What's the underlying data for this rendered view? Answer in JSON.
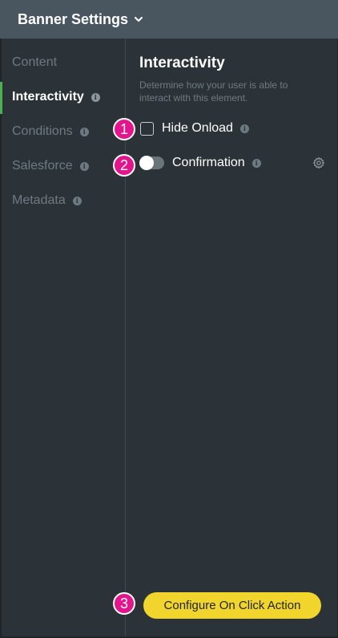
{
  "header": {
    "title": "Banner Settings",
    "chevron_icon": "chevron-down-icon"
  },
  "sidebar": {
    "items": [
      {
        "label": "Content",
        "info": false,
        "active": false
      },
      {
        "label": "Interactivity",
        "info": true,
        "active": true
      },
      {
        "label": "Conditions",
        "info": true,
        "active": false
      },
      {
        "label": "Salesforce",
        "info": true,
        "active": false
      },
      {
        "label": "Metadata",
        "info": true,
        "active": false
      }
    ],
    "info_glyph": "i",
    "active_color": "#4caf50"
  },
  "main": {
    "title": "Interactivity",
    "subtitle": "Determine how your user is able to interact with this element.",
    "hide_onload": {
      "label": "Hide Onload",
      "checked": false
    },
    "confirmation": {
      "label": "Confirmation",
      "enabled": false,
      "settings_icon": "gear-icon"
    },
    "cta_label": "Configure On Click Action"
  },
  "annotations": {
    "badge_1": "1",
    "badge_2": "2",
    "badge_3": "3",
    "color": "#e3148c"
  },
  "colors": {
    "header_bg": "#4a565f",
    "panel_bg": "#2b3338",
    "muted_text": "#6e7a82",
    "cta_bg": "#f2d52c"
  }
}
